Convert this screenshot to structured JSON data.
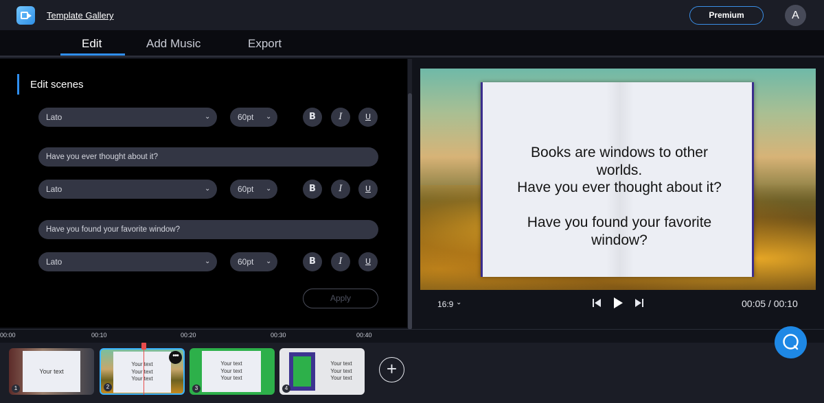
{
  "header": {
    "gallery_link": "Template Gallery",
    "premium_label": "Premium",
    "avatar_initial": "A"
  },
  "tabs": [
    {
      "label": "Edit",
      "active": true
    },
    {
      "label": "Add Music",
      "active": false
    },
    {
      "label": "Export",
      "active": false
    }
  ],
  "editor": {
    "title": "Edit scenes",
    "rows": [
      {
        "text": "",
        "font": "Lato",
        "size": "60pt"
      },
      {
        "text": "Have you ever thought about it?",
        "font": "Lato",
        "size": "60pt"
      },
      {
        "text": "Have you found your favorite window?",
        "font": "Lato",
        "size": "60pt"
      }
    ],
    "format_buttons": {
      "bold": "B",
      "italic": "I",
      "underline": "U"
    },
    "apply_label": "Apply"
  },
  "preview": {
    "text_lines": [
      "Books are windows to other",
      "worlds.",
      "Have you ever thought about it?",
      "Have you found your favorite",
      "window?"
    ],
    "aspect_ratio": "16:9",
    "timecode": "00:05 / 00:10"
  },
  "timeline": {
    "ticks": [
      "00:00",
      "00:10",
      "00:20",
      "00:30",
      "00:40"
    ],
    "scenes": [
      {
        "number": "1",
        "lines": [
          "Your text"
        ]
      },
      {
        "number": "2",
        "lines": [
          "Your text",
          "Your text",
          "Your text"
        ]
      },
      {
        "number": "3",
        "lines": [
          "Your text",
          "Your text",
          "Your text"
        ]
      },
      {
        "number": "4",
        "lines": [
          "Your text",
          "Your text",
          "Your text"
        ]
      }
    ],
    "add_label": "+"
  },
  "colors": {
    "accent": "#2f8ff0",
    "playhead": "#e84c4c",
    "chat": "#1e88e5"
  }
}
